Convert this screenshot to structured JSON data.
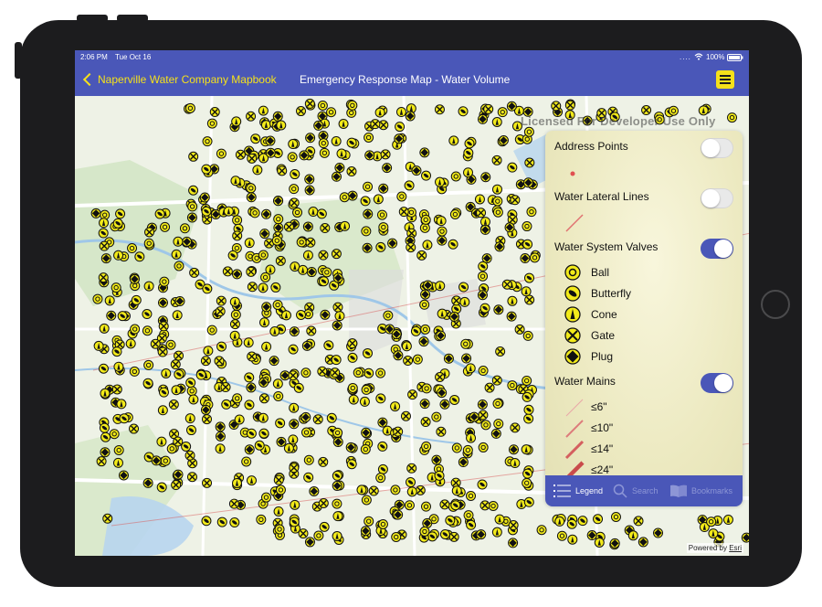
{
  "status_bar": {
    "time": "2:06 PM",
    "date": "Tue Oct 16",
    "battery": "100%"
  },
  "nav": {
    "back_label": "Naperville Water Company Mapbook",
    "title": "Emergency Response Map - Water Volume",
    "menu_icon": "hamburger-menu-icon"
  },
  "map": {
    "watermark": "Licensed For Developer Use Only",
    "attribution_prefix": "Powered by",
    "attribution_brand": "Esri"
  },
  "legend": {
    "layers": [
      {
        "name": "Address Points",
        "enabled": false
      },
      {
        "name": "Water Lateral Lines",
        "enabled": false
      },
      {
        "name": "Water System Valves",
        "enabled": true,
        "items": [
          "Ball",
          "Butterfly",
          "Cone",
          "Gate",
          "Plug"
        ]
      },
      {
        "name": "Water Mains",
        "enabled": true,
        "items": [
          "≤6\"",
          "≤10\"",
          "≤14\"",
          "≤24\""
        ]
      }
    ]
  },
  "tabs": [
    {
      "label": "Legend",
      "icon": "list-icon",
      "active": true
    },
    {
      "label": "Search",
      "icon": "search-icon",
      "active": false
    },
    {
      "label": "Bookmarks",
      "icon": "book-icon",
      "active": false
    }
  ],
  "colors": {
    "nav": "#4a57b8",
    "accent": "#f5e11a",
    "valve_fill": "#f2ea1a",
    "main_line": "#d95a5a"
  }
}
